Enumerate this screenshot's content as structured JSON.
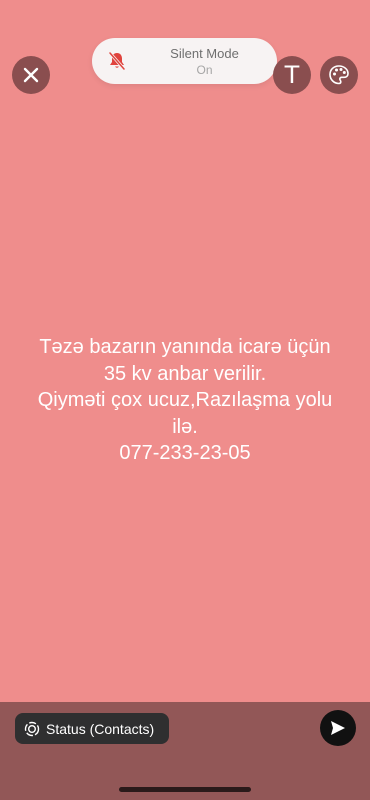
{
  "top_bar": {
    "close_icon": "close-icon",
    "text_tool_label": "T",
    "palette_icon": "palette-icon"
  },
  "silent_banner": {
    "title": "Silent Mode",
    "state": "On",
    "icon": "bell-slash-icon",
    "icon_color": "#e0433d"
  },
  "status": {
    "lines": [
      "Təzə bazarın yanında icarə üçün",
      "35 kv anbar verilir.",
      "Qiyməti çox ucuz,Razılaşma yolu",
      "ilə.",
      "077-233-23-05"
    ],
    "background_color": "#ef8d8c",
    "text_color": "#ffffff"
  },
  "bottom_bar": {
    "audience_label": "Status (Contacts)",
    "audience_icon": "status-ring-icon",
    "send_icon": "send-icon"
  }
}
